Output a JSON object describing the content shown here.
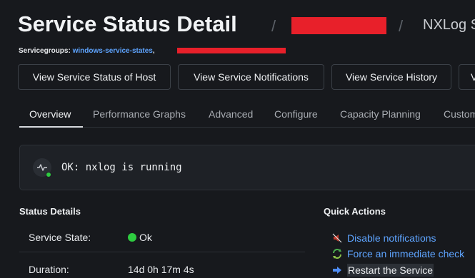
{
  "header": {
    "title": "Service Status Detail",
    "separator": "/",
    "service_crumb": "NXLog S",
    "servicegroups_label": "Servicegroups:",
    "servicegroup_link": "windows-service-states",
    "servicegroup_comma": ","
  },
  "actions": [
    "View Service Status of Host",
    "View Service Notifications",
    "View Service History",
    "V"
  ],
  "tabs": [
    "Overview",
    "Performance Graphs",
    "Advanced",
    "Configure",
    "Capacity Planning",
    "Custom"
  ],
  "active_tab": "Overview",
  "status": {
    "output": "OK: nxlog is running",
    "indicator_color": "#2ecc40"
  },
  "details": {
    "heading": "Status Details",
    "rows": [
      {
        "label": "Service State:",
        "value": "Ok"
      },
      {
        "label": "Duration:",
        "value": "14d 0h 17m 4s"
      }
    ]
  },
  "quick_actions": {
    "heading": "Quick Actions",
    "items": [
      {
        "label": "Disable notifications",
        "icon": "mute-speaker-icon"
      },
      {
        "label": "Force an immediate check",
        "icon": "refresh-arrows-icon"
      },
      {
        "label": "Restart the Service",
        "icon": "right-arrow-icon"
      }
    ]
  },
  "colors": {
    "background": "#17191d",
    "link": "#5ea4ff",
    "ok": "#2ecc40",
    "redaction": "#e8202a"
  }
}
